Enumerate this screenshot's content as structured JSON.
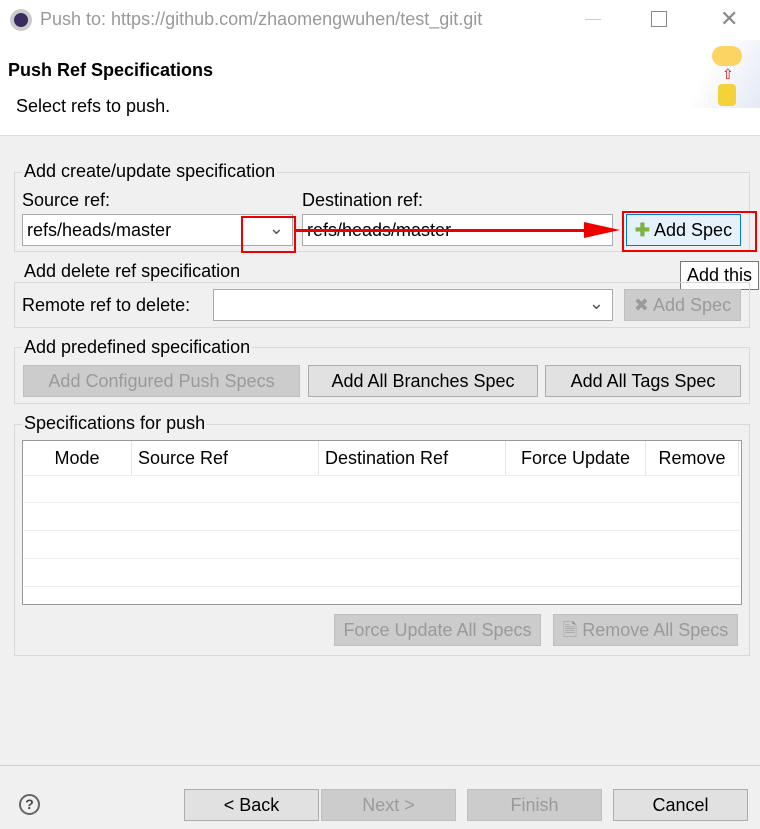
{
  "window": {
    "title": "Push to: https://github.com/zhaomengwuhen/test_git.git"
  },
  "header": {
    "title": "Push Ref Specifications",
    "subtitle": "Select refs to push."
  },
  "create": {
    "legend": "Add create/update specification",
    "source_label": "Source ref:",
    "source_value": "refs/heads/master",
    "dest_label": "Destination ref:",
    "dest_value": "refs/heads/master",
    "add_label": "Add Spec",
    "tooltip": "Add this"
  },
  "delete": {
    "legend": "Add delete ref specification",
    "remote_label": "Remote ref to delete:",
    "remote_value": "",
    "add_label": "Add Spec"
  },
  "predefined": {
    "legend": "Add predefined specification",
    "configured": "Add Configured Push Specs",
    "branches": "Add All Branches Spec",
    "tags": "Add All Tags Spec"
  },
  "specs": {
    "legend": "Specifications for push",
    "columns": [
      "Mode",
      "Source Ref",
      "Destination Ref",
      "Force Update",
      "Remove"
    ],
    "force_all": "Force Update All Specs",
    "remove_all": "Remove All Specs"
  },
  "footer": {
    "back": "< Back",
    "next": "Next >",
    "finish": "Finish",
    "cancel": "Cancel"
  },
  "colors": {
    "annotation": "#e00000",
    "accent": "#0078d7"
  }
}
